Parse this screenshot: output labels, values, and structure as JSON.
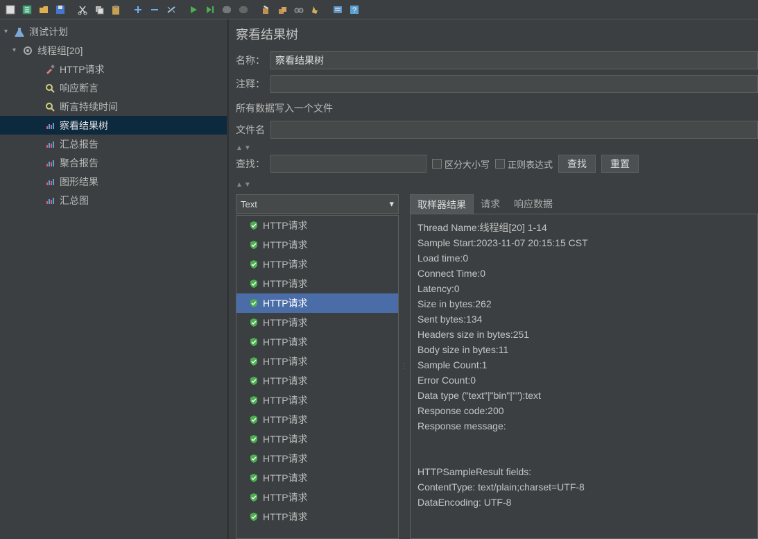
{
  "toolbar": {
    "icons": [
      "new-file",
      "template",
      "open",
      "save",
      "cut",
      "copy",
      "paste",
      "expand",
      "collapse",
      "toggle",
      "run",
      "run-next",
      "stop",
      "stop-all",
      "clear",
      "clear-all",
      "search",
      "cleanup",
      "functions",
      "help"
    ]
  },
  "tree": {
    "plan": {
      "label": "测试计划"
    },
    "threadGroup": {
      "label": "线程组[20]"
    },
    "items": [
      {
        "label": "HTTP请求",
        "icon": "pipette"
      },
      {
        "label": "响应断言",
        "icon": "magnifier"
      },
      {
        "label": "断言持续时间",
        "icon": "magnifier"
      },
      {
        "label": "察看结果树",
        "icon": "chart",
        "selected": true
      },
      {
        "label": "汇总报告",
        "icon": "chart"
      },
      {
        "label": "聚合报告",
        "icon": "chart"
      },
      {
        "label": "图形结果",
        "icon": "chart"
      },
      {
        "label": "汇总图",
        "icon": "chart"
      }
    ]
  },
  "panel": {
    "title": "察看结果树",
    "nameLabel": "名称：",
    "nameValue": "察看结果树",
    "noteLabel": "注释：",
    "noteValue": "",
    "writeFileLabel": "所有数据写入一个文件",
    "filenameLabel": "文件名",
    "filenameValue": "",
    "toggleArrows": "▲▼"
  },
  "search": {
    "label": "查找：",
    "value": "",
    "caseLabel": "区分大小写",
    "regexLabel": "正则表达式",
    "searchBtn": "查找",
    "resetBtn": "重置"
  },
  "renderer": {
    "selected": "Text"
  },
  "samples": [
    {
      "label": "HTTP请求"
    },
    {
      "label": "HTTP请求"
    },
    {
      "label": "HTTP请求"
    },
    {
      "label": "HTTP请求"
    },
    {
      "label": "HTTP请求",
      "selected": true
    },
    {
      "label": "HTTP请求"
    },
    {
      "label": "HTTP请求"
    },
    {
      "label": "HTTP请求"
    },
    {
      "label": "HTTP请求"
    },
    {
      "label": "HTTP请求"
    },
    {
      "label": "HTTP请求"
    },
    {
      "label": "HTTP请求"
    },
    {
      "label": "HTTP请求"
    },
    {
      "label": "HTTP请求"
    },
    {
      "label": "HTTP请求"
    },
    {
      "label": "HTTP请求"
    }
  ],
  "tabs": {
    "samplerResult": "取样器结果",
    "request": "请求",
    "responseData": "响应数据"
  },
  "result": {
    "lines": [
      "Thread Name:线程组[20] 1-14",
      "Sample Start:2023-11-07 20:15:15 CST",
      "Load time:0",
      "Connect Time:0",
      "Latency:0",
      "Size in bytes:262",
      "Sent bytes:134",
      "Headers size in bytes:251",
      "Body size in bytes:11",
      "Sample Count:1",
      "Error Count:0",
      "Data type (\"text\"|\"bin\"|\"\"):text",
      "Response code:200",
      "Response message:",
      "",
      "",
      "HTTPSampleResult fields:",
      "ContentType: text/plain;charset=UTF-8",
      "DataEncoding: UTF-8"
    ]
  }
}
